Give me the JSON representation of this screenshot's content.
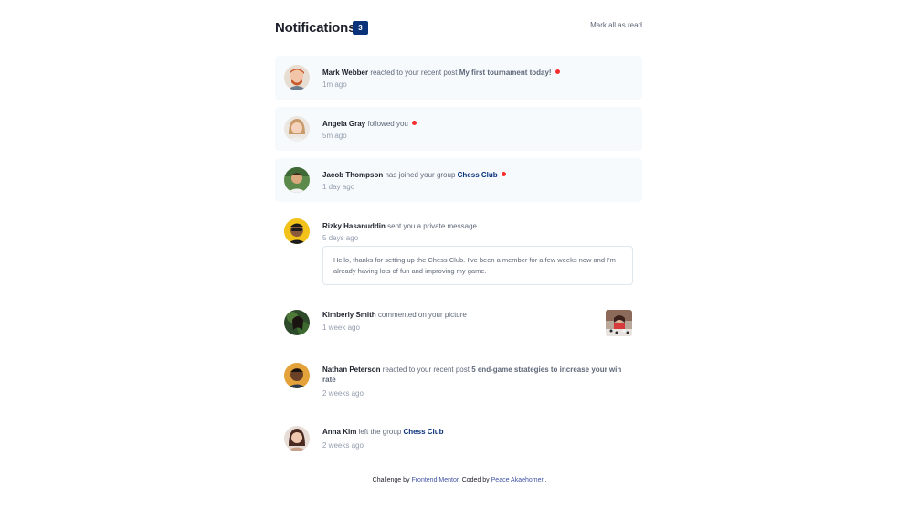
{
  "header": {
    "title": "Notifications",
    "count": "3",
    "mark_all": "Mark all as read"
  },
  "notifications": [
    {
      "name": "Mark Webber",
      "action": " reacted to your recent post ",
      "target": "My first tournament today!",
      "time": "1m ago",
      "unread": true
    },
    {
      "name": "Angela Gray",
      "action": " followed you",
      "time": "5m ago",
      "unread": true
    },
    {
      "name": "Jacob Thompson",
      "action": " has joined your group ",
      "group": "Chess Club",
      "time": "1 day ago",
      "unread": true
    },
    {
      "name": "Rizky Hasanuddin",
      "action": " sent you a private message",
      "time": "5 days ago",
      "unread": false,
      "message": "Hello, thanks for setting up the Chess Club. I've been a member for a few weeks now and I'm already having lots of fun and improving my game."
    },
    {
      "name": "Kimberly Smith",
      "action": " commented on your picture",
      "time": "1 week ago",
      "unread": false
    },
    {
      "name": "Nathan Peterson",
      "action": " reacted to your recent post ",
      "target": "5 end-game strategies to increase your win rate",
      "time": "2 weeks ago",
      "unread": false
    },
    {
      "name": "Anna Kim",
      "action": " left the group ",
      "group": "Chess Club",
      "time": "2 weeks ago",
      "unread": false
    }
  ],
  "footer": {
    "prefix": "Challenge by ",
    "link1": "Frontend Mentor",
    "middle": ". Coded by ",
    "link2": "Peace Akaehomen",
    "suffix": "."
  },
  "colors": {
    "accent": "#0a327b",
    "unread_bg": "#f6fafd",
    "dot": "#f62d2d"
  }
}
